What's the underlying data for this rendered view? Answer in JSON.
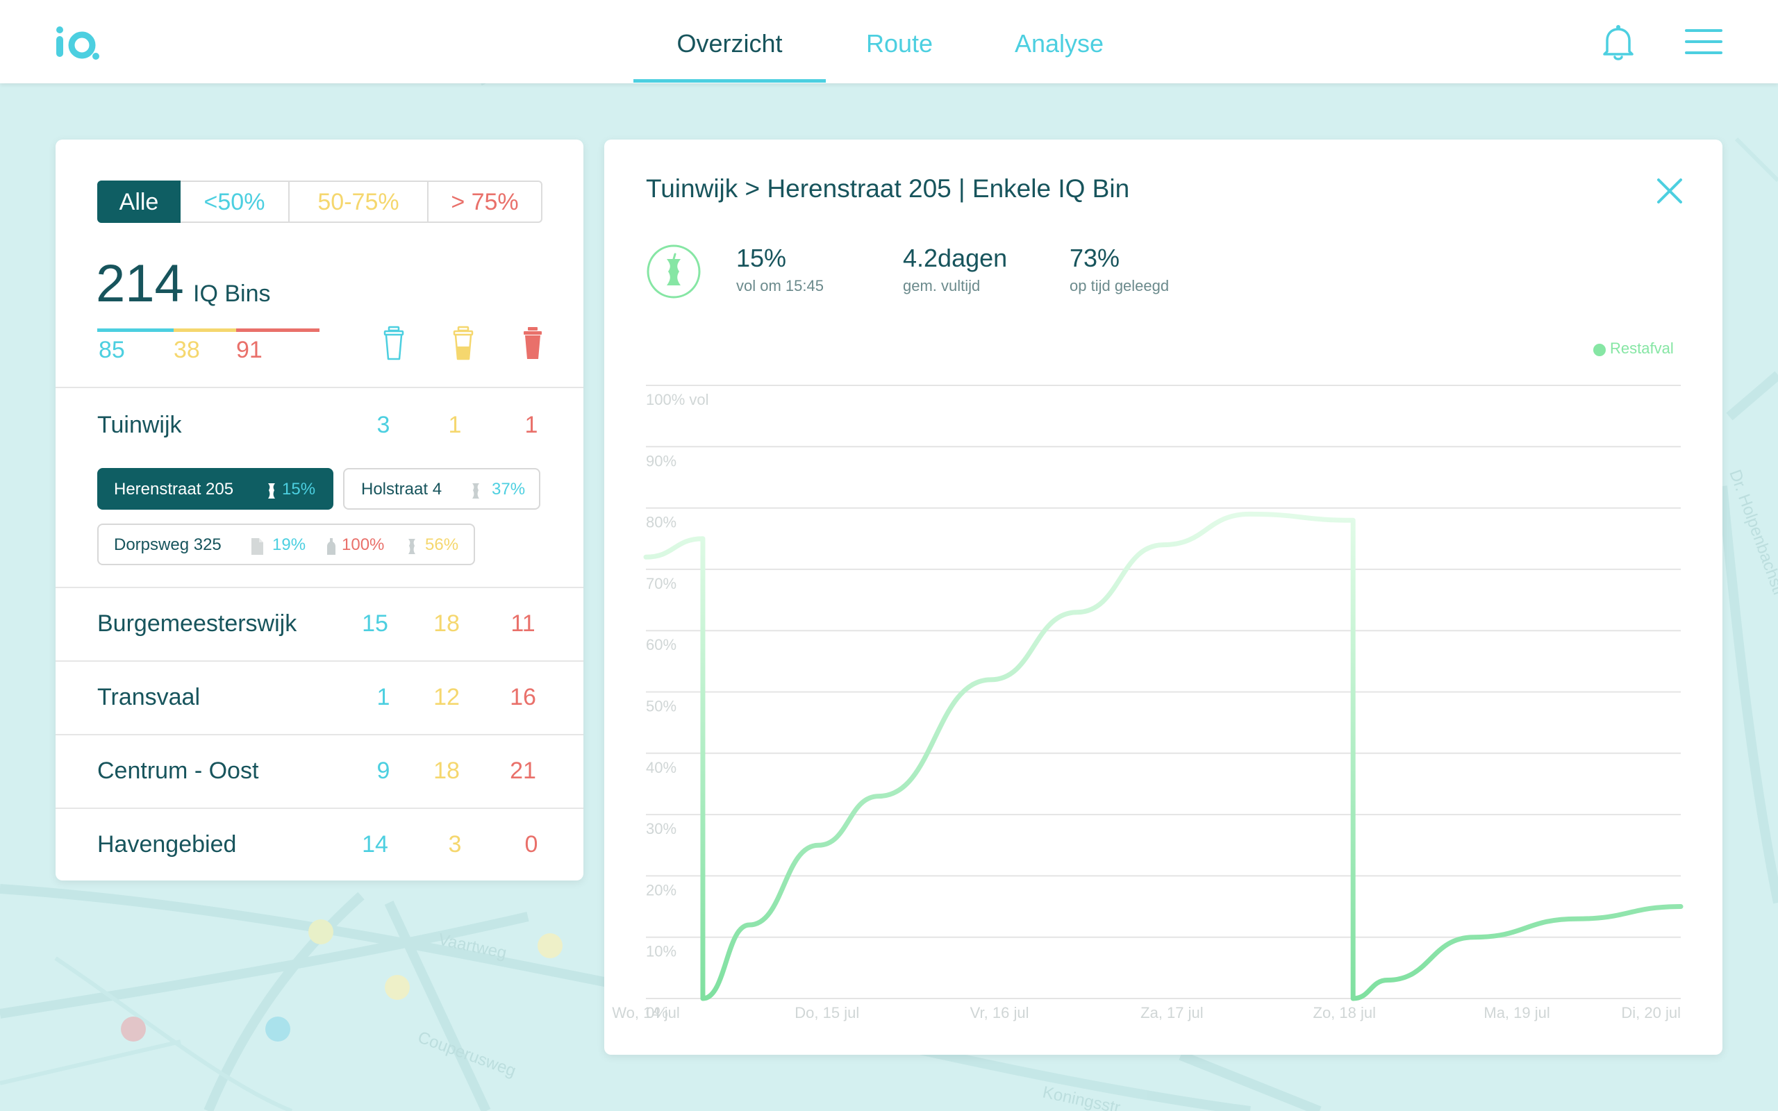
{
  "app": {
    "logo_text": "iQ"
  },
  "nav": {
    "tabs": [
      {
        "label": "Overzicht",
        "active": true
      },
      {
        "label": "Route",
        "active": false
      },
      {
        "label": "Analyse",
        "active": false
      }
    ]
  },
  "colors": {
    "teal_dark": "#0f5e63",
    "text": "#17545c",
    "cyan": "#4ccfe0",
    "yellow": "#f5d76e",
    "red": "#e9706a",
    "green": "#86e6a4"
  },
  "filters": [
    "Alle",
    "<50%",
    "50-75%",
    "> 75%"
  ],
  "summary": {
    "total": "214",
    "total_label": "IQ Bins",
    "low": "85",
    "mid": "38",
    "high": "91"
  },
  "districts": [
    {
      "name": "Tuinwijk",
      "low": "3",
      "mid": "1",
      "high": "1",
      "bins": [
        {
          "name": "Herenstraat 205",
          "readings": [
            "15%"
          ]
        },
        {
          "name": "Holstraat 4",
          "readings": [
            "37%"
          ]
        },
        {
          "name": "Dorpsweg 325",
          "readings": [
            "19%",
            "100%",
            "56%"
          ]
        }
      ]
    },
    {
      "name": "Burgemeesterswijk",
      "low": "15",
      "mid": "18",
      "high": "11"
    },
    {
      "name": "Transvaal",
      "low": "1",
      "mid": "12",
      "high": "16"
    },
    {
      "name": "Centrum - Oost",
      "low": "9",
      "mid": "18",
      "high": "21"
    },
    {
      "name": "Havengebied",
      "low": "14",
      "mid": "3",
      "high": "0"
    }
  ],
  "detail": {
    "title": "Tuinwijk > Herenstraat 205  |  Enkele IQ Bin",
    "stats": [
      {
        "value": "15%",
        "label": "vol om 15:45"
      },
      {
        "value": "4.2dagen",
        "label": "gem. vultijd"
      },
      {
        "value": "73%",
        "label": "op tijd geleegd"
      }
    ]
  },
  "chart_data": {
    "type": "line",
    "title": "",
    "xlabel": "",
    "ylabel": "",
    "y_ticks": [
      "0%",
      "10%",
      "20%",
      "30%",
      "40%",
      "50%",
      "60%",
      "70%",
      "80%",
      "90%",
      "100% vol"
    ],
    "x_ticks": [
      "Wo, 14 jul",
      "Do, 15 jul",
      "Vr, 16 jul",
      "Za, 17 jul",
      "Zo, 18 jul",
      "Ma, 19 jul",
      "Di, 20 jul"
    ],
    "ylim": [
      0,
      100
    ],
    "xlim": [
      0,
      6
    ],
    "grid": true,
    "legend": "top-right",
    "series": [
      {
        "name": "Restafval",
        "color": "#86e6a4",
        "points": [
          [
            0,
            72
          ],
          [
            0.33,
            75
          ],
          [
            0.33,
            0
          ],
          [
            0.6,
            12
          ],
          [
            1.0,
            25
          ],
          [
            1.35,
            33
          ],
          [
            2.0,
            52
          ],
          [
            2.5,
            63
          ],
          [
            3.0,
            74
          ],
          [
            3.5,
            79
          ],
          [
            4.1,
            78
          ],
          [
            4.1,
            0
          ],
          [
            4.3,
            3
          ],
          [
            4.8,
            10
          ],
          [
            5.4,
            13
          ],
          [
            6.0,
            15
          ]
        ]
      }
    ]
  }
}
